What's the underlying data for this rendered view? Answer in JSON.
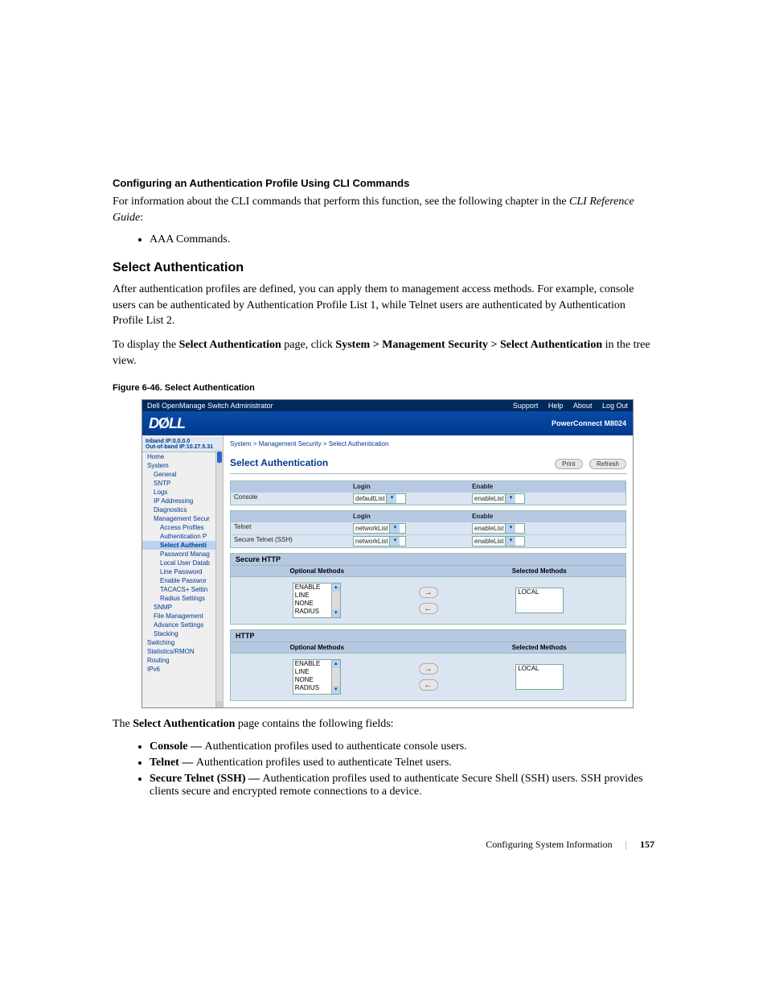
{
  "heading_cli": "Configuring an Authentication Profile Using CLI Commands",
  "cli_para_a": "For information about the CLI commands that perform this function, see the following chapter in the ",
  "cli_para_b": "CLI Reference Guide",
  "cli_para_c": ":",
  "cli_bullet": "AAA Commands.",
  "section_title": "Select Authentication",
  "sa_para1": "After authentication profiles are defined, you can apply them to management access methods. For example, console users can be authenticated by Authentication Profile List 1, while Telnet users are authenticated by Authentication Profile List 2.",
  "sa_para2_a": "To display the ",
  "sa_para2_b": "Select Authentication",
  "sa_para2_c": " page, click ",
  "sa_para2_d": "System > Management Security > Select Authentication",
  "sa_para2_e": " in the tree view.",
  "figure_caption": "Figure 6-46.    Select Authentication",
  "screenshot": {
    "topbar_left": "Dell OpenManage Switch Administrator",
    "topbar_right": [
      "Support",
      "Help",
      "About",
      "Log Out"
    ],
    "logo": "DELL",
    "product": "PowerConnect M8024",
    "ipbox_l1": "Inband IP:0.0.0.0",
    "ipbox_l2": "Out-of-band IP:10.27.5.31",
    "breadcrumb": "System > Management Security > Select Authentication",
    "page_title": "Select Authentication",
    "btn_print": "Print",
    "btn_refresh": "Refresh",
    "tree": [
      {
        "t": "Home",
        "i": 0
      },
      {
        "t": "System",
        "i": 0
      },
      {
        "t": "General",
        "i": 1
      },
      {
        "t": "SNTP",
        "i": 1
      },
      {
        "t": "Logs",
        "i": 1
      },
      {
        "t": "IP Addressing",
        "i": 1
      },
      {
        "t": "Diagnostics",
        "i": 1
      },
      {
        "t": "Management Secur",
        "i": 1
      },
      {
        "t": "Access Profiles",
        "i": 2
      },
      {
        "t": "Authentication P",
        "i": 2
      },
      {
        "t": "Select Authenti",
        "i": 2,
        "sel": true
      },
      {
        "t": "Password Manag",
        "i": 2
      },
      {
        "t": "Local User Datab",
        "i": 2
      },
      {
        "t": "Line Password",
        "i": 2
      },
      {
        "t": "Enable Passwor",
        "i": 2
      },
      {
        "t": "TACACS+ Settin",
        "i": 2
      },
      {
        "t": "Radius Settings",
        "i": 2
      },
      {
        "t": "SNMP",
        "i": 1
      },
      {
        "t": "File Management",
        "i": 1
      },
      {
        "t": "Advance Settings",
        "i": 1
      },
      {
        "t": "Stacking",
        "i": 1
      },
      {
        "t": "Switching",
        "i": 0
      },
      {
        "t": "Statistics/RMON",
        "i": 0
      },
      {
        "t": "Routing",
        "i": 0
      },
      {
        "t": "IPv6",
        "i": 0
      }
    ],
    "hdr_login": "Login",
    "hdr_enable": "Enable",
    "row_console": "Console",
    "val_defaultList": "defaultList",
    "val_enableList": "enableList",
    "row_telnet": "Telnet",
    "row_ssh": "Secure Telnet (SSH)",
    "val_networkList": "networkList",
    "title_secure_http": "Secure HTTP",
    "title_http": "HTTP",
    "hdr_optional": "Optional Methods",
    "hdr_selected": "Selected Methods",
    "opts": [
      "ENABLE",
      "LINE",
      "NONE",
      "RADIUS"
    ],
    "sel_local": "LOCAL"
  },
  "after_fig": "The ",
  "after_fig_b": "Select Authentication",
  "after_fig_c": " page contains the following fields:",
  "fields": [
    {
      "b": "Console — ",
      "t": "Authentication profiles used to authenticate console users."
    },
    {
      "b": "Telnet — ",
      "t": "Authentication profiles used to authenticate Telnet users."
    },
    {
      "b": "Secure Telnet (SSH) — ",
      "t": "Authentication profiles used to authenticate Secure Shell (SSH) users. SSH provides clients secure and encrypted remote connections to a device."
    }
  ],
  "footer_section": "Configuring System Information",
  "footer_page": "157"
}
